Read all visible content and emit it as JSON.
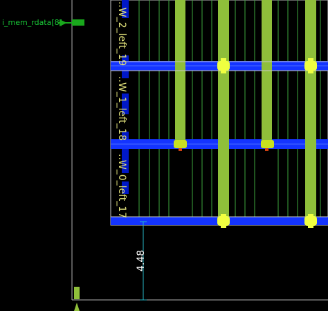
{
  "pin": {
    "label": "i_mem_rdata[8]"
  },
  "instances": [
    {
      "label": "..W_2_left_19"
    },
    {
      "label": "..W_1_left_18"
    },
    {
      "label": "..W_0_left_17"
    }
  ],
  "ruler": {
    "value": "4.48"
  },
  "colors": {
    "background": "#000000",
    "pin_green": "#19a81c",
    "instance_text": "#e0e07a",
    "metal_blue": "#1434ff",
    "metal_blue_dark": "#0018c8",
    "power_strap": "#8fbf3a",
    "thin_wire": "#3ea83e",
    "outline": "#c8c8c8",
    "via": "#f0ff40",
    "ruler": "#27b8c8"
  }
}
